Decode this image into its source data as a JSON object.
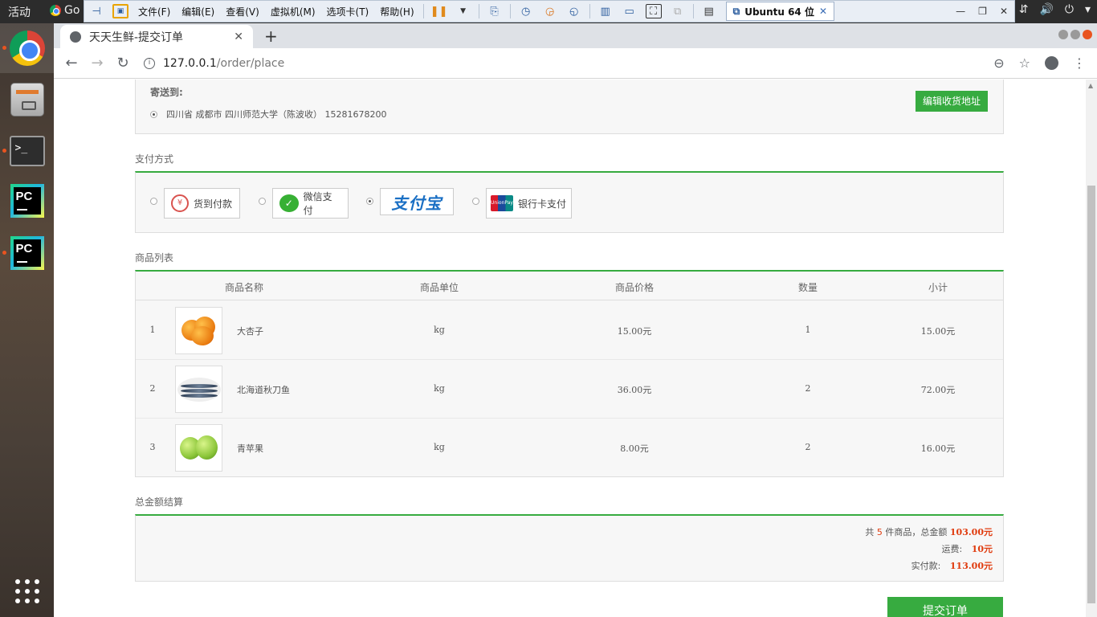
{
  "os": {
    "activities": "活动",
    "app_label": "Go",
    "dock": [
      "chrome",
      "files",
      "terminal",
      "pycharm",
      "pycharm",
      "show-apps"
    ]
  },
  "vmware": {
    "menu": [
      "文件(F)",
      "编辑(E)",
      "查看(V)",
      "虚拟机(M)",
      "选项卡(T)",
      "帮助(H)"
    ],
    "tab_title": "Ubuntu 64 位"
  },
  "browser": {
    "tab_title": "天天生鲜-提交订单",
    "url_host": "127.0.0.1",
    "url_path": "/order/place"
  },
  "address": {
    "label": "寄送到:",
    "line": "四川省 成都市 四川师范大学（陈波收） 15281678200",
    "edit_button": "编辑收货地址"
  },
  "payment": {
    "title": "支付方式",
    "options": [
      {
        "label": "货到付款",
        "selected": false,
        "icon": "cash-on-delivery-icon"
      },
      {
        "label": "微信支付",
        "selected": false,
        "icon": "wechat-pay-icon"
      },
      {
        "label": "支付宝",
        "selected": true,
        "icon": "alipay-logo"
      },
      {
        "label": "银行卡支付",
        "selected": false,
        "icon": "unionpay-icon"
      }
    ]
  },
  "goods": {
    "title": "商品列表",
    "headers": [
      "商品名称",
      "商品单位",
      "商品价格",
      "数量",
      "小计"
    ],
    "rows": [
      {
        "index": "1",
        "name": "大杏子",
        "unit": "kg",
        "price": "15.00元",
        "qty": "1",
        "subtotal": "15.00元"
      },
      {
        "index": "2",
        "name": "北海道秋刀鱼",
        "unit": "kg",
        "price": "36.00元",
        "qty": "2",
        "subtotal": "72.00元"
      },
      {
        "index": "3",
        "name": "青苹果",
        "unit": "kg",
        "price": "8.00元",
        "qty": "2",
        "subtotal": "16.00元"
      }
    ]
  },
  "total": {
    "title": "总金额结算",
    "prefix": "共",
    "count": "5",
    "mid": "件商品，总金额",
    "amount": "103.00元",
    "freight_label": "运费:",
    "freight": "10元",
    "paid_label": "实付款:",
    "paid": "113.00元"
  },
  "submit_button": "提交订单",
  "colors": {
    "accent": "#37ab40",
    "price": "#e03c0f"
  }
}
